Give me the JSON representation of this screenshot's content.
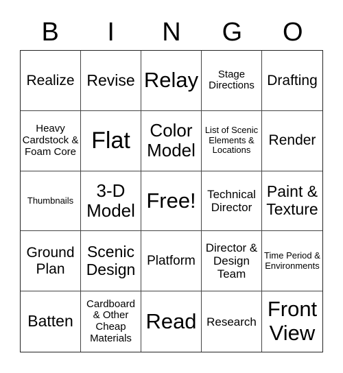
{
  "header": [
    "B",
    "I",
    "N",
    "G",
    "O"
  ],
  "cells": [
    "Realize",
    "Revise",
    "Relay",
    "Stage Directions",
    "Drafting",
    "Heavy Cardstock & Foam Core",
    "Flat",
    "Color Model",
    "List of Scenic Elements & Locations",
    "Render",
    "Thumbnails",
    "3-D Model",
    "Free!",
    "Technical Director",
    "Paint & Texture",
    "Ground Plan",
    "Scenic Design",
    "Platform",
    "Director & Design Team",
    "Time Period & Environments",
    "Batten",
    "Cardboard & Other Cheap Materials",
    "Read",
    "Research",
    "Front View"
  ]
}
